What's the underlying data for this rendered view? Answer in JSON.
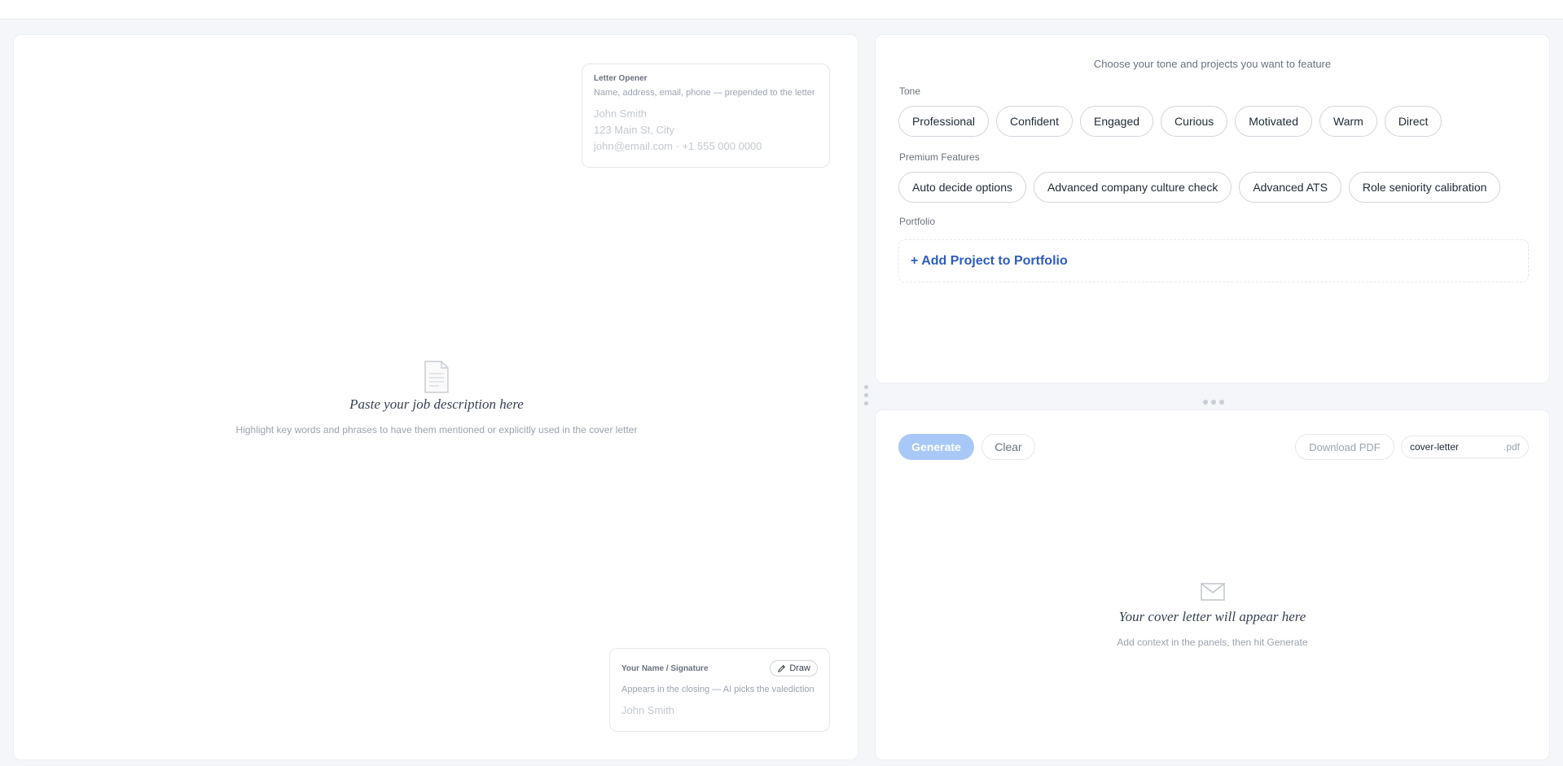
{
  "opener": {
    "title": "Letter Opener",
    "subtitle": "Name, address, email, phone — prepended to the letter",
    "lines": [
      "John Smith",
      "123 Main St, City",
      "john@email.com · +1 555 000 0000"
    ]
  },
  "paste": {
    "title": "Paste your job description here",
    "subtitle": "Highlight key words and phrases to have them mentioned or explicitly used in the cover letter",
    "icon": "document-icon"
  },
  "signature": {
    "title": "Your Name / Signature",
    "draw_label": "Draw",
    "subtitle": "Appears in the closing — AI picks the valediction",
    "placeholder": "John Smith"
  },
  "options": {
    "header": "Choose your tone and projects you want to feature",
    "tone_label": "Tone",
    "tones": [
      "Professional",
      "Confident",
      "Engaged",
      "Curious",
      "Motivated",
      "Warm",
      "Direct"
    ],
    "premium_label": "Premium Features",
    "premium": [
      "Auto decide options",
      "Advanced company culture check",
      "Advanced ATS",
      "Role seniority calibration"
    ],
    "portfolio_label": "Portfolio",
    "add_project": "+ Add Project to Portfolio"
  },
  "output": {
    "generate_label": "Generate",
    "clear_label": "Clear",
    "download_label": "Download PDF",
    "filename": "cover-letter",
    "extension": ".pdf",
    "title": "Your cover letter will appear here",
    "subtitle": "Add context in the panels, then hit Generate",
    "icon": "mail-icon"
  },
  "colors": {
    "accent": "#2e5cc2",
    "generate_disabled": "#a8c8f8"
  }
}
